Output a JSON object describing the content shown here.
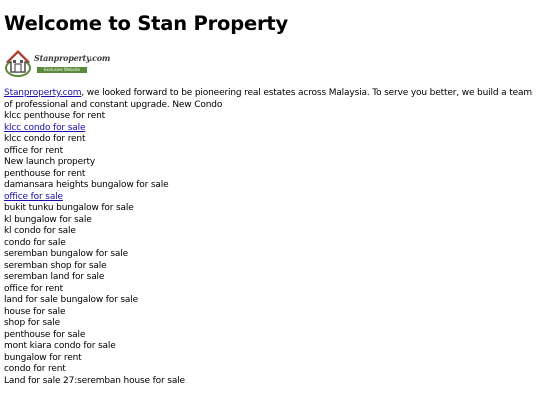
{
  "page": {
    "title": "Welcome to Stan Property"
  },
  "logo": {
    "text": "Stanproperty.com",
    "tagline": "Exclusive Website"
  },
  "intro": {
    "link_text": "Stanproperty.com",
    "text": ", we looked forward to be pioneering real estates across Malaysia. To serve you better, we build a team of professional and constant upgrade. New Condo"
  },
  "lines": [
    {
      "text": "klcc penthouse for rent",
      "link": false
    },
    {
      "text": "klcc condo for sale",
      "link": true
    },
    {
      "text": "klcc condo for rent",
      "link": false
    },
    {
      "text": "office for rent",
      "link": false
    },
    {
      "text": "New launch property",
      "link": false
    },
    {
      "text": "penthouse for rent",
      "link": false
    },
    {
      "text": "damansara heights bungalow for sale",
      "link": false
    },
    {
      "text": "office for sale",
      "link": true
    },
    {
      "text": "bukit tunku bungalow for sale",
      "link": false
    },
    {
      "text": "kl bungalow for sale",
      "link": false
    },
    {
      "text": "kl condo for sale",
      "link": false
    },
    {
      "text": "condo for sale",
      "link": false
    },
    {
      "text": "seremban bungalow for sale",
      "link": false
    },
    {
      "text": "seremban shop for sale",
      "link": false
    },
    {
      "text": "seremban land for sale",
      "link": false
    },
    {
      "text": "office for rent",
      "link": false
    },
    {
      "text": "land for sale bungalow for sale",
      "link": false
    },
    {
      "text": "house for sale",
      "link": false
    },
    {
      "text": "shop for sale",
      "link": false
    },
    {
      "text": "penthouse for sale",
      "link": false
    },
    {
      "text": "mont kiara condo for sale",
      "link": false
    },
    {
      "text": "bungalow for rent",
      "link": false
    },
    {
      "text": "condo for rent",
      "link": false
    },
    {
      "text": "Land for sale 27:seremban house for sale",
      "link": false
    }
  ],
  "colors": {
    "link": "#1a0dab",
    "text": "#000000",
    "logo_green": "#5b8a3a",
    "logo_red": "#b23a2a"
  }
}
